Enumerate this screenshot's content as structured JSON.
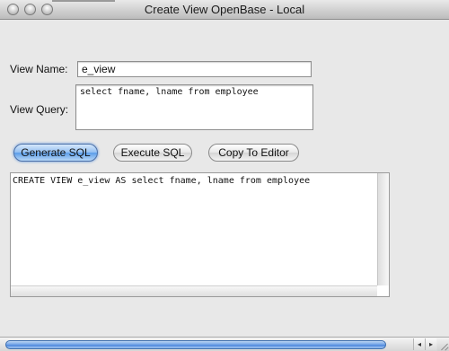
{
  "window": {
    "title": "Create View OpenBase - Local"
  },
  "form": {
    "view_name_label": "View Name:",
    "view_name_value": "e_view",
    "view_query_label": "View Query:",
    "view_query_value": "select fname, lname from employee"
  },
  "buttons": {
    "generate_sql": "Generate SQL",
    "execute_sql": "Execute SQL",
    "copy_to_editor": "Copy To Editor"
  },
  "output": {
    "sql_text": "CREATE VIEW e_view AS select fname, lname from employee"
  },
  "scrollbar": {
    "left_arrow": "◂",
    "right_arrow": "▸"
  },
  "icons": {
    "close": "close-icon",
    "minimize": "minimize-icon",
    "zoom": "zoom-icon"
  }
}
